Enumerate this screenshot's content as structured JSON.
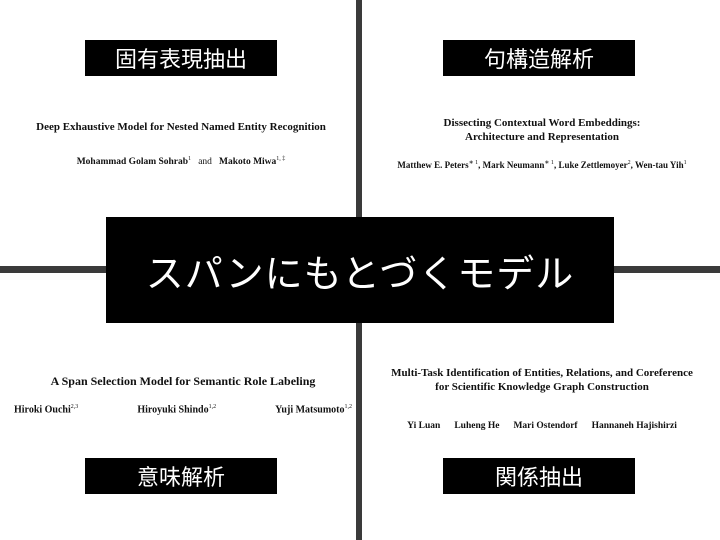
{
  "quadrants": {
    "top_left": {
      "label": "固有表現抽出",
      "paper_title": "Deep Exhaustive Model for Nested Named Entity Recognition",
      "authors": [
        {
          "name": "Mohammad Golam Sohrab",
          "sup": "1"
        },
        {
          "name": "Makoto Miwa",
          "sup": "1, ‡"
        }
      ],
      "conjunction": "and"
    },
    "top_right": {
      "label": "句構造解析",
      "paper_title_line1": "Dissecting Contextual Word Embeddings:",
      "paper_title_line2": "Architecture and Representation",
      "authors": [
        {
          "name": "Matthew E. Peters",
          "sup": "∗ 1"
        },
        {
          "name": "Mark Neumann",
          "sup": "∗ 1"
        },
        {
          "name": "Luke Zettlemoyer",
          "sup": "2"
        },
        {
          "name": "Wen-tau Yih",
          "sup": "1"
        }
      ]
    },
    "bottom_left": {
      "label": "意味解析",
      "paper_title": "A Span Selection Model for Semantic Role Labeling",
      "authors": [
        {
          "name": "Hiroki Ouchi",
          "sup": "2,3"
        },
        {
          "name": "Hiroyuki Shindo",
          "sup": "1,2"
        },
        {
          "name": "Yuji Matsumoto",
          "sup": "1,2"
        }
      ]
    },
    "bottom_right": {
      "label": "関係抽出",
      "paper_title_line1": "Multi-Task Identification of Entities, Relations, and Coreference",
      "paper_title_line2": "for Scientific Knowledge Graph Construction",
      "authors": [
        {
          "name": "Yi Luan"
        },
        {
          "name": "Luheng He"
        },
        {
          "name": "Mari Ostendorf"
        },
        {
          "name": "Hannaneh Hajishirzi"
        }
      ]
    }
  },
  "center_banner": "スパンにもとづくモデル",
  "colors": {
    "background": "#ffffff",
    "box": "#000000",
    "box_text": "#ffffff",
    "divider": "#3a3a3a"
  }
}
